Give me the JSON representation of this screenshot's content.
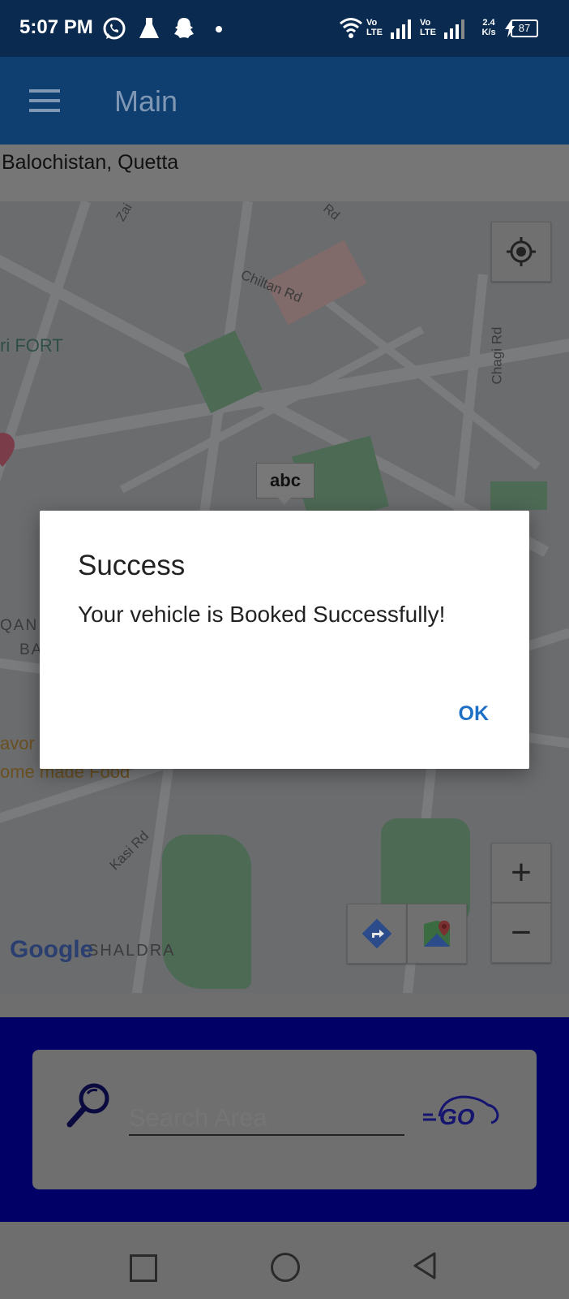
{
  "status_bar": {
    "time": "5:07 PM",
    "net_speed_value": "2.4",
    "net_speed_unit": "K/s",
    "battery": "87",
    "icons": [
      "whatsapp-icon",
      "flask-icon",
      "snapchat-icon",
      "dot-icon",
      "wifi-icon",
      "volte-signal-icon",
      "volte-signal-icon",
      "charging-icon",
      "battery-icon"
    ]
  },
  "app_bar": {
    "title": "Main"
  },
  "location": {
    "label": "Balochistan, Quetta"
  },
  "map": {
    "labels": {
      "chiltan_rd": "Chiltan Rd",
      "chagi_rd": "Chagi Rd",
      "fort": "ri FORT",
      "kasi_rd": "Kasi Rd",
      "shaldra": "SHALDRA",
      "qan": "QAN",
      "ba": "BA",
      "avor": "avor",
      "home_made_food": "ome made Food",
      "zai": "Zai",
      "rd_top": "Rd"
    },
    "marker_label": "abc",
    "google_logo": "Google"
  },
  "dialog": {
    "title": "Success",
    "message": "Your vehicle is Booked Successfully!",
    "ok": "OK"
  },
  "search": {
    "placeholder": "Search Area",
    "value": "Search Area",
    "go_label": "GO"
  },
  "colors": {
    "status_bar": "#0a2a4f",
    "app_bar": "#0f3f70",
    "bottom_panel": "#000066",
    "dialog_button": "#1e70c6"
  }
}
